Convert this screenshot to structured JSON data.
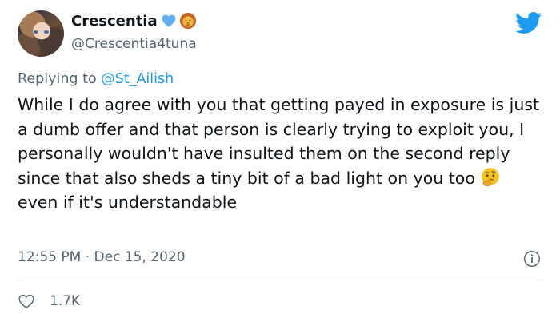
{
  "author": {
    "display_name": "Crescentia",
    "handle": "@Crescentia4tuna",
    "badges": [
      "blue-heart-icon",
      "lion-icon"
    ]
  },
  "reply": {
    "prefix": "Replying to ",
    "to": "@St_Ailish"
  },
  "tweet": {
    "text_part1": "While I do agree with you that getting payed in exposure is just a dumb offer and that person is clearly trying to exploit you, I personally wouldn't have insulted them on the second reply since that also sheds a tiny bit of a bad light on you too",
    "emoji": "thinking-face-icon",
    "text_part2": "even if it's understandable"
  },
  "meta": {
    "time": "12:55 PM",
    "separator": " · ",
    "date": "Dec 15, 2020"
  },
  "stats": {
    "likes": "1.7K"
  },
  "colors": {
    "accent": "#1d9bf0",
    "text": "#0f1419",
    "secondary": "#536471",
    "heart": "#5fb0f2"
  }
}
